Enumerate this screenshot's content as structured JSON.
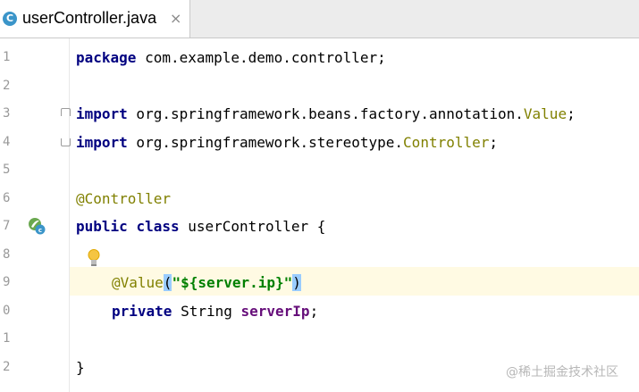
{
  "tab": {
    "title": "userController.java",
    "icon_letter": "C",
    "close_glyph": "×"
  },
  "line_numbers": [
    "1",
    "2",
    "3",
    "4",
    "5",
    "6",
    "7",
    "8",
    "9",
    "0",
    "1",
    "2"
  ],
  "code": {
    "l1_kw": "package",
    "l1_rest": " com.example.demo.controller;",
    "l3_kw": "import",
    "l3_pkg": " org.springframework.beans.factory.annotation.",
    "l3_cls": "Value",
    "l3_end": ";",
    "l4_kw": "import",
    "l4_pkg": " org.springframework.stereotype.",
    "l4_cls": "Controller",
    "l4_end": ";",
    "l6_ann": "@Controller",
    "l7_kw1": "public",
    "l7_kw2": "class",
    "l7_rest": " userController {",
    "l9_ann": "@Value",
    "l9_lp": "(",
    "l9_str": "\"${server.ip}\"",
    "l9_rp": ")",
    "l10_kw": "private",
    "l10_type": " String ",
    "l10_field": "serverIp",
    "l10_end": ";",
    "l12": "}"
  },
  "watermark": "@稀土掘金技术社区",
  "colors": {
    "keyword": "#000080",
    "annotation": "#808000",
    "string": "#008000",
    "field": "#660e7a",
    "caret_row": "#fffae3",
    "brace_highlight": "#99ccff"
  }
}
